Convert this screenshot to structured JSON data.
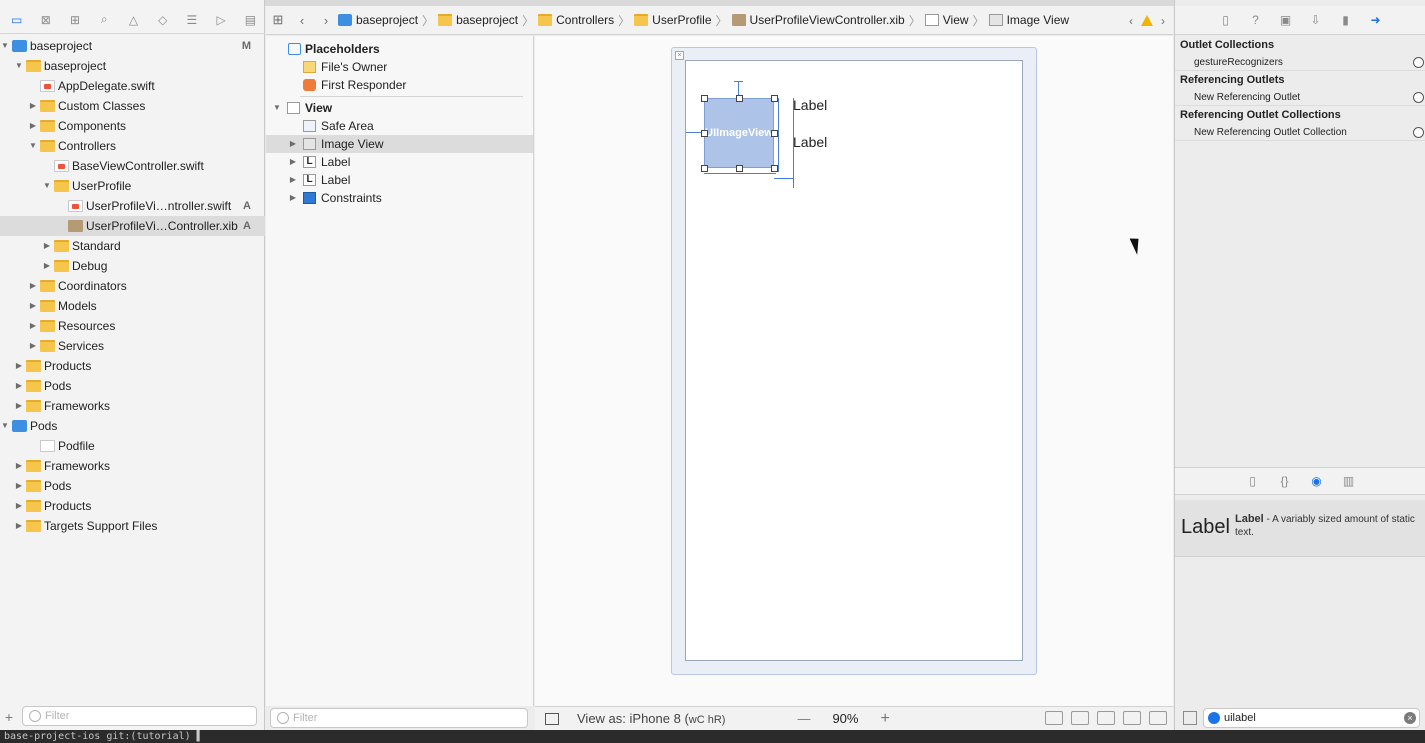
{
  "navigator": {
    "rows": [
      {
        "label": "baseproject",
        "indent": 0,
        "tri": "open",
        "icon": "proj",
        "badge": "M"
      },
      {
        "label": "baseproject",
        "indent": 1,
        "tri": "open",
        "icon": "folder",
        "badge": ""
      },
      {
        "label": "AppDelegate.swift",
        "indent": 2,
        "tri": "",
        "icon": "swift",
        "badge": ""
      },
      {
        "label": "Custom Classes",
        "indent": 2,
        "tri": "closed",
        "icon": "folder",
        "badge": ""
      },
      {
        "label": "Components",
        "indent": 2,
        "tri": "closed",
        "icon": "folder",
        "badge": ""
      },
      {
        "label": "Controllers",
        "indent": 2,
        "tri": "open",
        "icon": "folder",
        "badge": ""
      },
      {
        "label": "BaseViewController.swift",
        "indent": 3,
        "tri": "",
        "icon": "swift",
        "badge": ""
      },
      {
        "label": "UserProfile",
        "indent": 3,
        "tri": "open",
        "icon": "folder",
        "badge": ""
      },
      {
        "label": "UserProfileVi…ntroller.swift",
        "indent": 4,
        "tri": "",
        "icon": "swift",
        "badge": "A"
      },
      {
        "label": "UserProfileVi…Controller.xib",
        "indent": 4,
        "tri": "",
        "icon": "xib",
        "badge": "A",
        "selected": true
      },
      {
        "label": "Standard",
        "indent": 3,
        "tri": "closed",
        "icon": "folder",
        "badge": ""
      },
      {
        "label": "Debug",
        "indent": 3,
        "tri": "closed",
        "icon": "folder",
        "badge": ""
      },
      {
        "label": "Coordinators",
        "indent": 2,
        "tri": "closed",
        "icon": "folder",
        "badge": ""
      },
      {
        "label": "Models",
        "indent": 2,
        "tri": "closed",
        "icon": "folder",
        "badge": ""
      },
      {
        "label": "Resources",
        "indent": 2,
        "tri": "closed",
        "icon": "folder",
        "badge": ""
      },
      {
        "label": "Services",
        "indent": 2,
        "tri": "closed",
        "icon": "folder",
        "badge": ""
      },
      {
        "label": "Products",
        "indent": 1,
        "tri": "closed",
        "icon": "folder",
        "badge": ""
      },
      {
        "label": "Pods",
        "indent": 1,
        "tri": "closed",
        "icon": "folder",
        "badge": ""
      },
      {
        "label": "Frameworks",
        "indent": 1,
        "tri": "closed",
        "icon": "folder",
        "badge": ""
      },
      {
        "label": "Pods",
        "indent": 0,
        "tri": "open",
        "icon": "proj",
        "badge": ""
      },
      {
        "label": "Podfile",
        "indent": 2,
        "tri": "",
        "icon": "pod",
        "badge": ""
      },
      {
        "label": "Frameworks",
        "indent": 1,
        "tri": "closed",
        "icon": "folder",
        "badge": ""
      },
      {
        "label": "Pods",
        "indent": 1,
        "tri": "closed",
        "icon": "folder",
        "badge": ""
      },
      {
        "label": "Products",
        "indent": 1,
        "tri": "closed",
        "icon": "folder",
        "badge": ""
      },
      {
        "label": "Targets Support Files",
        "indent": 1,
        "tri": "closed",
        "icon": "folder",
        "badge": ""
      }
    ],
    "filter_placeholder": "Filter"
  },
  "jumpbar": {
    "crumbs": [
      "baseproject",
      "baseproject",
      "Controllers",
      "UserProfile",
      "UserProfileViewController.xib",
      "View",
      "Image View"
    ]
  },
  "outline": {
    "placeholders": "Placeholders",
    "files_owner": "File's Owner",
    "first_responder": "First Responder",
    "view": "View",
    "safe_area": "Safe Area",
    "image_view": "Image View",
    "label1": "Label",
    "label2": "Label",
    "constraints": "Constraints",
    "filter_placeholder": "Filter"
  },
  "canvas": {
    "image_view_text": "UIImageView",
    "label1": "Label",
    "label2": "Label",
    "view_as": "View as: iPhone 8 (",
    "size_class": "wC hR)",
    "zoom_minus": "—",
    "zoom": "90%",
    "zoom_plus": "+"
  },
  "inspector": {
    "outlet_collections": "Outlet Collections",
    "gesture": "gestureRecognizers",
    "referencing_outlets": "Referencing Outlets",
    "new_ref_outlet": "New Referencing Outlet",
    "referencing_outlet_collections": "Referencing Outlet Collections",
    "new_ref_outlet_collection": "New Referencing Outlet Collection",
    "library_item_big": "Label",
    "library_item_name": "Label",
    "library_item_desc": " - A variably sized amount of static text.",
    "search_value": "uilabel"
  },
  "terminal": {
    "line1": "base-project-ios git:(tutorial) ▌"
  }
}
